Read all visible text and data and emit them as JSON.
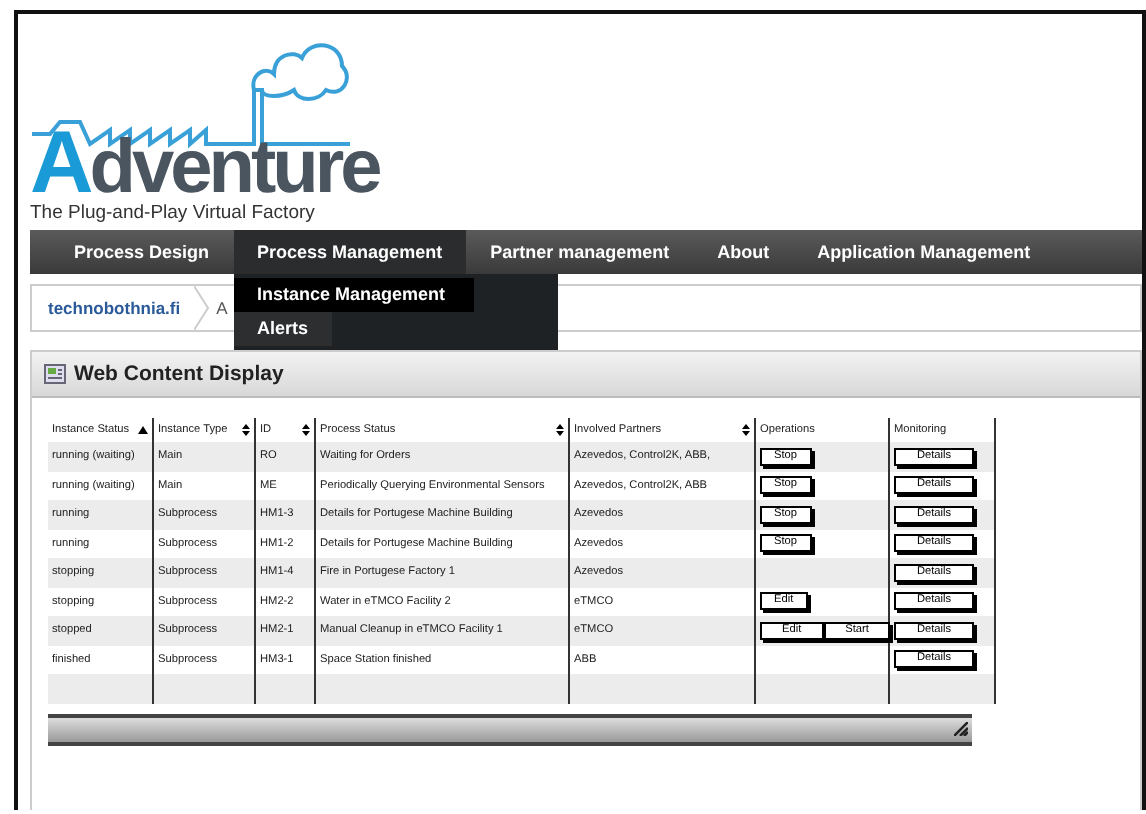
{
  "logo": {
    "name": "Adventure",
    "tagline": "The Plug-and-Play Virtual Factory"
  },
  "nav": {
    "items": [
      {
        "label": "Process Design",
        "selected": false
      },
      {
        "label": "Process Management",
        "selected": true,
        "dropdown": [
          {
            "label": "Instance Management",
            "selected": true
          },
          {
            "label": "Alerts",
            "selected": false
          }
        ]
      },
      {
        "label": "Partner management",
        "selected": false
      },
      {
        "label": "About",
        "selected": false
      },
      {
        "label": "Application Management",
        "selected": false
      }
    ]
  },
  "breadcrumb": [
    "technobothnia.fi",
    "A"
  ],
  "portlet": {
    "title": "Web Content Display"
  },
  "table": {
    "columns": [
      {
        "label": "Instance Status",
        "sortable": true,
        "sorted_ascending": true
      },
      {
        "label": "Instance Type",
        "sortable": true,
        "sorted_ascending": false
      },
      {
        "label": "ID",
        "sortable": true,
        "sorted_ascending": false
      },
      {
        "label": "Process Status",
        "sortable": true,
        "sorted_ascending": false
      },
      {
        "label": "Involved Partners",
        "sortable": true,
        "sorted_ascending": false
      },
      {
        "label": "Operations",
        "sortable": false
      },
      {
        "label": "Monitoring",
        "sortable": false
      }
    ],
    "rows": [
      {
        "status": "running (waiting)",
        "type": "Main",
        "id": "RO",
        "process_status": "Waiting for Orders",
        "partners": "Azevedos, Control2K, ABB,",
        "operations": [
          "Stop"
        ],
        "monitoring": "Details"
      },
      {
        "status": "running (waiting)",
        "type": "Main",
        "id": "ME",
        "process_status": "Periodically Querying Environmental Sensors",
        "partners": "Azevedos, Control2K, ABB",
        "operations": [
          "Stop"
        ],
        "monitoring": "Details"
      },
      {
        "status": "running",
        "type": "Subprocess",
        "id": "HM1-3",
        "process_status": "Details for Portugese Machine Building",
        "partners": "Azevedos",
        "operations": [
          "Stop"
        ],
        "monitoring": "Details"
      },
      {
        "status": "running",
        "type": "Subprocess",
        "id": "HM1-2",
        "process_status": "Details for Portugese Machine Building",
        "partners": "Azevedos",
        "operations": [
          "Stop"
        ],
        "monitoring": "Details"
      },
      {
        "status": "stopping",
        "type": "Subprocess",
        "id": "HM1-4",
        "process_status": "Fire in Portugese Factory 1",
        "partners": "Azevedos",
        "operations": [],
        "monitoring": "Details"
      },
      {
        "status": "stopping",
        "type": "Subprocess",
        "id": "HM2-2",
        "process_status": "Water in eTMCO Facility 2",
        "partners": "eTMCO",
        "operations": [
          "Edit"
        ],
        "monitoring": "Details"
      },
      {
        "status": "stopped",
        "type": "Subprocess",
        "id": "HM2-1",
        "process_status": "Manual Cleanup in eTMCO Facility 1",
        "partners": "eTMCO",
        "operations": [
          "Edit",
          "Start"
        ],
        "monitoring": "Details"
      },
      {
        "status": "finished",
        "type": "Subprocess",
        "id": "HM3-1",
        "process_status": "Space Station finished",
        "partners": "ABB",
        "operations": [],
        "monitoring": "Details"
      }
    ]
  }
}
